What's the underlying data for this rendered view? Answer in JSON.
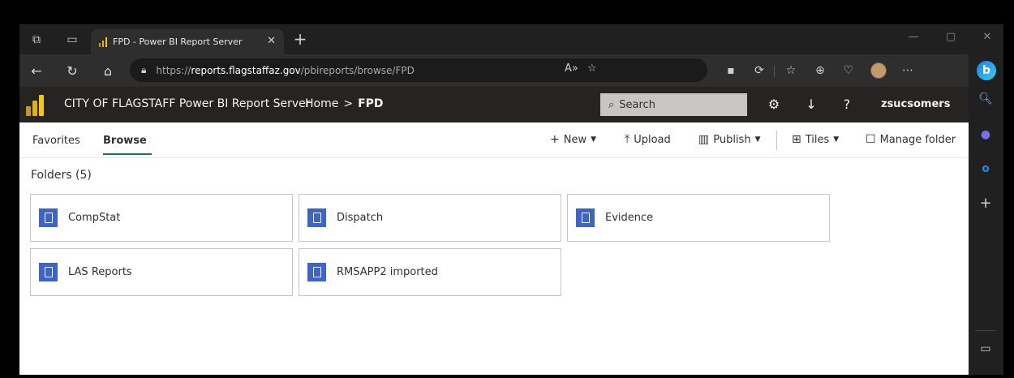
{
  "browser": {
    "tab_title": "FPD - Power BI Report Server",
    "url_prefix": "https://",
    "url_domain": "reports.flagstaffaz.gov",
    "url_path": "/pbireports/browse/FPD"
  },
  "header": {
    "title": "CITY OF FLAGSTAFF Power BI Report Server",
    "breadcrumb_home": "Home",
    "breadcrumb_separator": ">",
    "breadcrumb_current": "FPD",
    "search_placeholder": "Search",
    "user": "zsucsomers"
  },
  "nav": {
    "favorites": "Favorites",
    "browse": "Browse"
  },
  "commands": {
    "new": "New",
    "upload": "Upload",
    "publish": "Publish",
    "tiles": "Tiles",
    "manage_folder": "Manage folder"
  },
  "folders_heading": "Folders (5)",
  "folders": [
    {
      "name": "CompStat"
    },
    {
      "name": "Dispatch"
    },
    {
      "name": "Evidence"
    },
    {
      "name": "LAS Reports"
    },
    {
      "name": "RMSAPP2 imported"
    }
  ],
  "colors": {
    "accent": "#0e7a64",
    "tile_icon": "#3d64cc",
    "pbi_yellow": "#f2c811"
  },
  "icons": {
    "workspaces": "workspaces-icon",
    "tab_actions": "tab-actions-icon",
    "powerbi": "powerbi-icon",
    "folder": "folder-icon"
  }
}
